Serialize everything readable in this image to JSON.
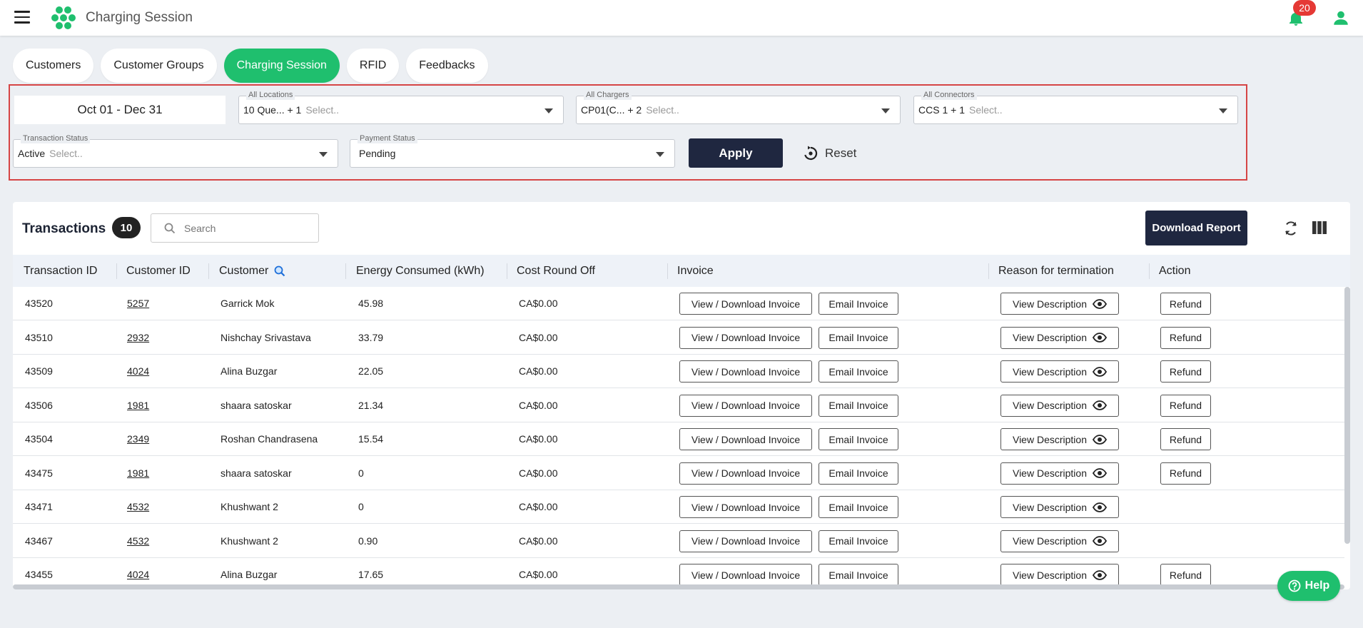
{
  "header": {
    "title": "Charging Session",
    "notification_count": "20",
    "brand_color": "#1fbf6e"
  },
  "tabs": [
    {
      "label": "Customers",
      "active": false
    },
    {
      "label": "Customer Groups",
      "active": false
    },
    {
      "label": "Charging Session",
      "active": true
    },
    {
      "label": "RFID",
      "active": false
    },
    {
      "label": "Feedbacks",
      "active": false
    }
  ],
  "filters": {
    "date_range": "Oct 01 - Dec 31",
    "locations": {
      "label": "All Locations",
      "value": "10 Que... + 1",
      "placeholder": "Select.."
    },
    "chargers": {
      "label": "All Chargers",
      "value": "CP01(C... + 2",
      "placeholder": "Select.."
    },
    "connectors": {
      "label": "All Connectors",
      "value": "CCS 1 + 1",
      "placeholder": "Select.."
    },
    "transaction_status": {
      "label": "Transaction Status",
      "value": "Active",
      "placeholder": "Select.."
    },
    "payment_status": {
      "label": "Payment Status",
      "value": "Pending"
    },
    "apply_label": "Apply",
    "reset_label": "Reset"
  },
  "transactions": {
    "title": "Transactions",
    "count": "10",
    "search_placeholder": "Search",
    "download_label": "Download Report",
    "columns": [
      "Transaction ID",
      "Customer ID",
      "Customer",
      "Energy Consumed (kWh)",
      "Cost Round Off",
      "Invoice",
      "Reason for termination",
      "Action"
    ],
    "view_invoice_label": "View / Download Invoice",
    "email_invoice_label": "Email Invoice",
    "view_description_label": "View Description",
    "refund_label": "Refund",
    "rows": [
      {
        "transaction_id": "43520",
        "customer_id": "5257",
        "customer": "Garrick Mok",
        "energy": "45.98",
        "cost": "CA$0.00",
        "refund": true
      },
      {
        "transaction_id": "43510",
        "customer_id": "2932",
        "customer": "Nishchay Srivastava",
        "energy": "33.79",
        "cost": "CA$0.00",
        "refund": true
      },
      {
        "transaction_id": "43509",
        "customer_id": "4024",
        "customer": "Alina Buzgar",
        "energy": "22.05",
        "cost": "CA$0.00",
        "refund": true
      },
      {
        "transaction_id": "43506",
        "customer_id": "1981",
        "customer": "shaara satoskar",
        "energy": "21.34",
        "cost": "CA$0.00",
        "refund": true
      },
      {
        "transaction_id": "43504",
        "customer_id": "2349",
        "customer": "Roshan Chandrasena",
        "energy": "15.54",
        "cost": "CA$0.00",
        "refund": true
      },
      {
        "transaction_id": "43475",
        "customer_id": "1981",
        "customer": "shaara satoskar",
        "energy": "0",
        "cost": "CA$0.00",
        "refund": true
      },
      {
        "transaction_id": "43471",
        "customer_id": "4532",
        "customer": "Khushwant 2",
        "energy": "0",
        "cost": "CA$0.00",
        "refund": false
      },
      {
        "transaction_id": "43467",
        "customer_id": "4532",
        "customer": "Khushwant 2",
        "energy": "0.90",
        "cost": "CA$0.00",
        "refund": false
      },
      {
        "transaction_id": "43455",
        "customer_id": "4024",
        "customer": "Alina Buzgar",
        "energy": "17.65",
        "cost": "CA$0.00",
        "refund": true
      }
    ]
  },
  "help_label": "Help"
}
